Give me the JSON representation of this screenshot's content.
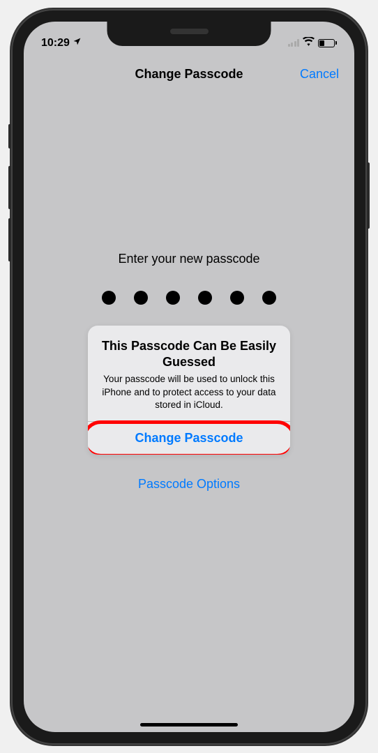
{
  "status_bar": {
    "time": "10:29"
  },
  "nav": {
    "title": "Change Passcode",
    "cancel": "Cancel"
  },
  "prompt": "Enter your new passcode",
  "alert": {
    "title": "This Passcode Can Be Easily Guessed",
    "body": "Your passcode will be used to unlock this iPhone and to protect access to your data stored in iCloud.",
    "button": "Change Passcode"
  },
  "passcode_options": "Passcode Options",
  "colors": {
    "link": "#007aff",
    "highlight": "#ff0000"
  }
}
